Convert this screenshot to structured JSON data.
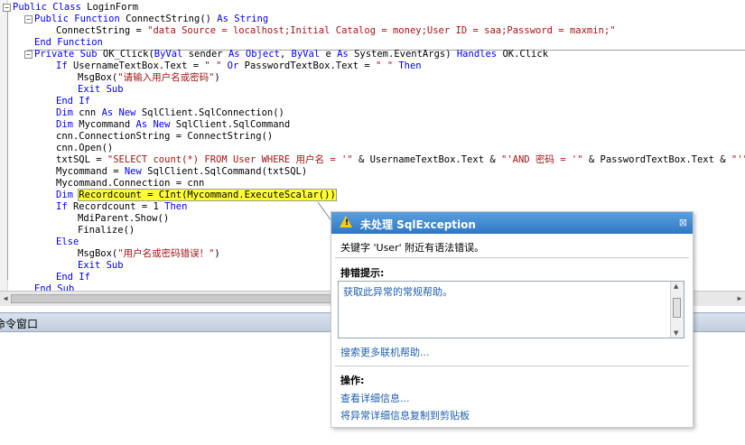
{
  "code_lines": [
    {
      "n": 0,
      "indent": 0,
      "parts": [
        {
          "t": "Public Class",
          "c": "kw"
        },
        {
          "t": " LoginForm",
          "c": ""
        }
      ]
    },
    {
      "n": 1,
      "indent": 1,
      "parts": [
        {
          "t": "Public Function",
          "c": "kw"
        },
        {
          "t": " ConnectString() ",
          "c": ""
        },
        {
          "t": "As String",
          "c": "kw"
        }
      ]
    },
    {
      "n": 2,
      "indent": 2,
      "parts": [
        {
          "t": "ConnectString = ",
          "c": ""
        },
        {
          "t": "\"data Source = localhost;Initial Catalog = money;User ID = saa;Password = maxmin;\"",
          "c": "str"
        }
      ]
    },
    {
      "n": 3,
      "indent": 1,
      "parts": [
        {
          "t": "End Function",
          "c": "kw"
        }
      ]
    },
    {
      "n": 4,
      "indent": 1,
      "parts": [
        {
          "t": "Private Sub",
          "c": "kw"
        },
        {
          "t": " OK_Click(",
          "c": ""
        },
        {
          "t": "ByVal",
          "c": "kw"
        },
        {
          "t": " sender ",
          "c": ""
        },
        {
          "t": "As Object",
          "c": "kw"
        },
        {
          "t": ", ",
          "c": ""
        },
        {
          "t": "ByVal",
          "c": "kw"
        },
        {
          "t": " e ",
          "c": ""
        },
        {
          "t": "As",
          "c": "kw"
        },
        {
          "t": " System.EventArgs) ",
          "c": ""
        },
        {
          "t": "Handles",
          "c": "kw"
        },
        {
          "t": " OK.Click",
          "c": ""
        }
      ]
    },
    {
      "n": 5,
      "indent": 2,
      "parts": [
        {
          "t": "If",
          "c": "kw"
        },
        {
          "t": " UsernameTextBox.Text = ",
          "c": ""
        },
        {
          "t": "\" \"",
          "c": "str"
        },
        {
          "t": " Or ",
          "c": "kw"
        },
        {
          "t": "PasswordTextBox.Text = ",
          "c": ""
        },
        {
          "t": "\" \"",
          "c": "str"
        },
        {
          "t": " Then",
          "c": "kw"
        }
      ]
    },
    {
      "n": 6,
      "indent": 3,
      "parts": [
        {
          "t": "MsgBox(",
          "c": ""
        },
        {
          "t": "\"请输入用户名或密码\"",
          "c": "str"
        },
        {
          "t": ")",
          "c": ""
        }
      ]
    },
    {
      "n": 7,
      "indent": 3,
      "parts": [
        {
          "t": "Exit Sub",
          "c": "kw"
        }
      ]
    },
    {
      "n": 8,
      "indent": 2,
      "parts": [
        {
          "t": "End If",
          "c": "kw"
        }
      ]
    },
    {
      "n": 9,
      "indent": 2,
      "parts": [
        {
          "t": "Dim",
          "c": "kw"
        },
        {
          "t": " cnn ",
          "c": ""
        },
        {
          "t": "As New",
          "c": "kw"
        },
        {
          "t": " SqlClient.SqlConnection()",
          "c": ""
        }
      ]
    },
    {
      "n": 10,
      "indent": 2,
      "parts": [
        {
          "t": "Dim",
          "c": "kw"
        },
        {
          "t": " Mycommand ",
          "c": ""
        },
        {
          "t": "As New",
          "c": "kw"
        },
        {
          "t": " SqlClient.SqlCommand",
          "c": ""
        }
      ]
    },
    {
      "n": 11,
      "indent": 2,
      "parts": [
        {
          "t": "cnn.ConnectionString = ConnectString()",
          "c": ""
        }
      ]
    },
    {
      "n": 12,
      "indent": 2,
      "parts": [
        {
          "t": "cnn.Open()",
          "c": ""
        }
      ]
    },
    {
      "n": 13,
      "indent": 2,
      "parts": [
        {
          "t": "txtSQL = ",
          "c": ""
        },
        {
          "t": "\"SELECT count(*) FROM User WHERE 用户名 = '\"",
          "c": "str"
        },
        {
          "t": " & UsernameTextBox.Text & ",
          "c": ""
        },
        {
          "t": "\"'AND 密码 = '\"",
          "c": "str"
        },
        {
          "t": " & PasswordTextBox.Text & ",
          "c": ""
        },
        {
          "t": "\"'\"",
          "c": "str"
        }
      ]
    },
    {
      "n": 14,
      "indent": 2,
      "parts": [
        {
          "t": "Mycommand = ",
          "c": ""
        },
        {
          "t": "New",
          "c": "kw"
        },
        {
          "t": " SqlClient.SqlCommand(txtSQL)",
          "c": ""
        }
      ]
    },
    {
      "n": 15,
      "indent": 2,
      "parts": [
        {
          "t": "Mycommand.Connection = cnn",
          "c": ""
        }
      ]
    },
    {
      "n": 16,
      "indent": 2,
      "parts": [
        {
          "t": "Dim",
          "c": "kw"
        },
        {
          "t": " ",
          "c": ""
        },
        {
          "t": "Recordcount = CInt(Mycommand.ExecuteScalar())",
          "c": "hl"
        }
      ]
    },
    {
      "n": 17,
      "indent": 2,
      "parts": [
        {
          "t": "If",
          "c": "kw"
        },
        {
          "t": " Recordcount = 1 ",
          "c": ""
        },
        {
          "t": "Then",
          "c": "kw"
        }
      ]
    },
    {
      "n": 18,
      "indent": 3,
      "parts": [
        {
          "t": "MdiParent.Show()",
          "c": ""
        }
      ]
    },
    {
      "n": 19,
      "indent": 3,
      "parts": [
        {
          "t": "Finalize()",
          "c": ""
        }
      ]
    },
    {
      "n": 20,
      "indent": 2,
      "parts": [
        {
          "t": "Else",
          "c": "kw"
        }
      ]
    },
    {
      "n": 21,
      "indent": 3,
      "parts": [
        {
          "t": "MsgBox(",
          "c": ""
        },
        {
          "t": "\"用户名或密码错误！\"",
          "c": "str"
        },
        {
          "t": ")",
          "c": ""
        }
      ]
    },
    {
      "n": 22,
      "indent": 3,
      "parts": [
        {
          "t": "Exit Sub",
          "c": "kw"
        }
      ]
    },
    {
      "n": 23,
      "indent": 2,
      "parts": [
        {
          "t": "End If",
          "c": "kw"
        }
      ]
    },
    {
      "n": 24,
      "indent": 1,
      "parts": [
        {
          "t": "End Sub",
          "c": "kw"
        }
      ]
    }
  ],
  "command_window": {
    "title": "命令窗口"
  },
  "exception": {
    "title": "未处理 SqlException",
    "message": "关键字 'User' 附近有语法错误。",
    "tips_heading": "排错提示:",
    "tips_link": "获取此异常的常规帮助。",
    "search_link": "搜索更多联机帮助...",
    "actions_heading": "操作:",
    "actions": [
      "查看详细信息...",
      "将异常详细信息复制到剪贴板"
    ],
    "close_glyph": "⊠"
  },
  "colors": {
    "keyword": "#0000ff",
    "string": "#a31515",
    "highlight": "#ffff33",
    "title_bar": "#3a83cf",
    "link": "#1f5fae"
  }
}
